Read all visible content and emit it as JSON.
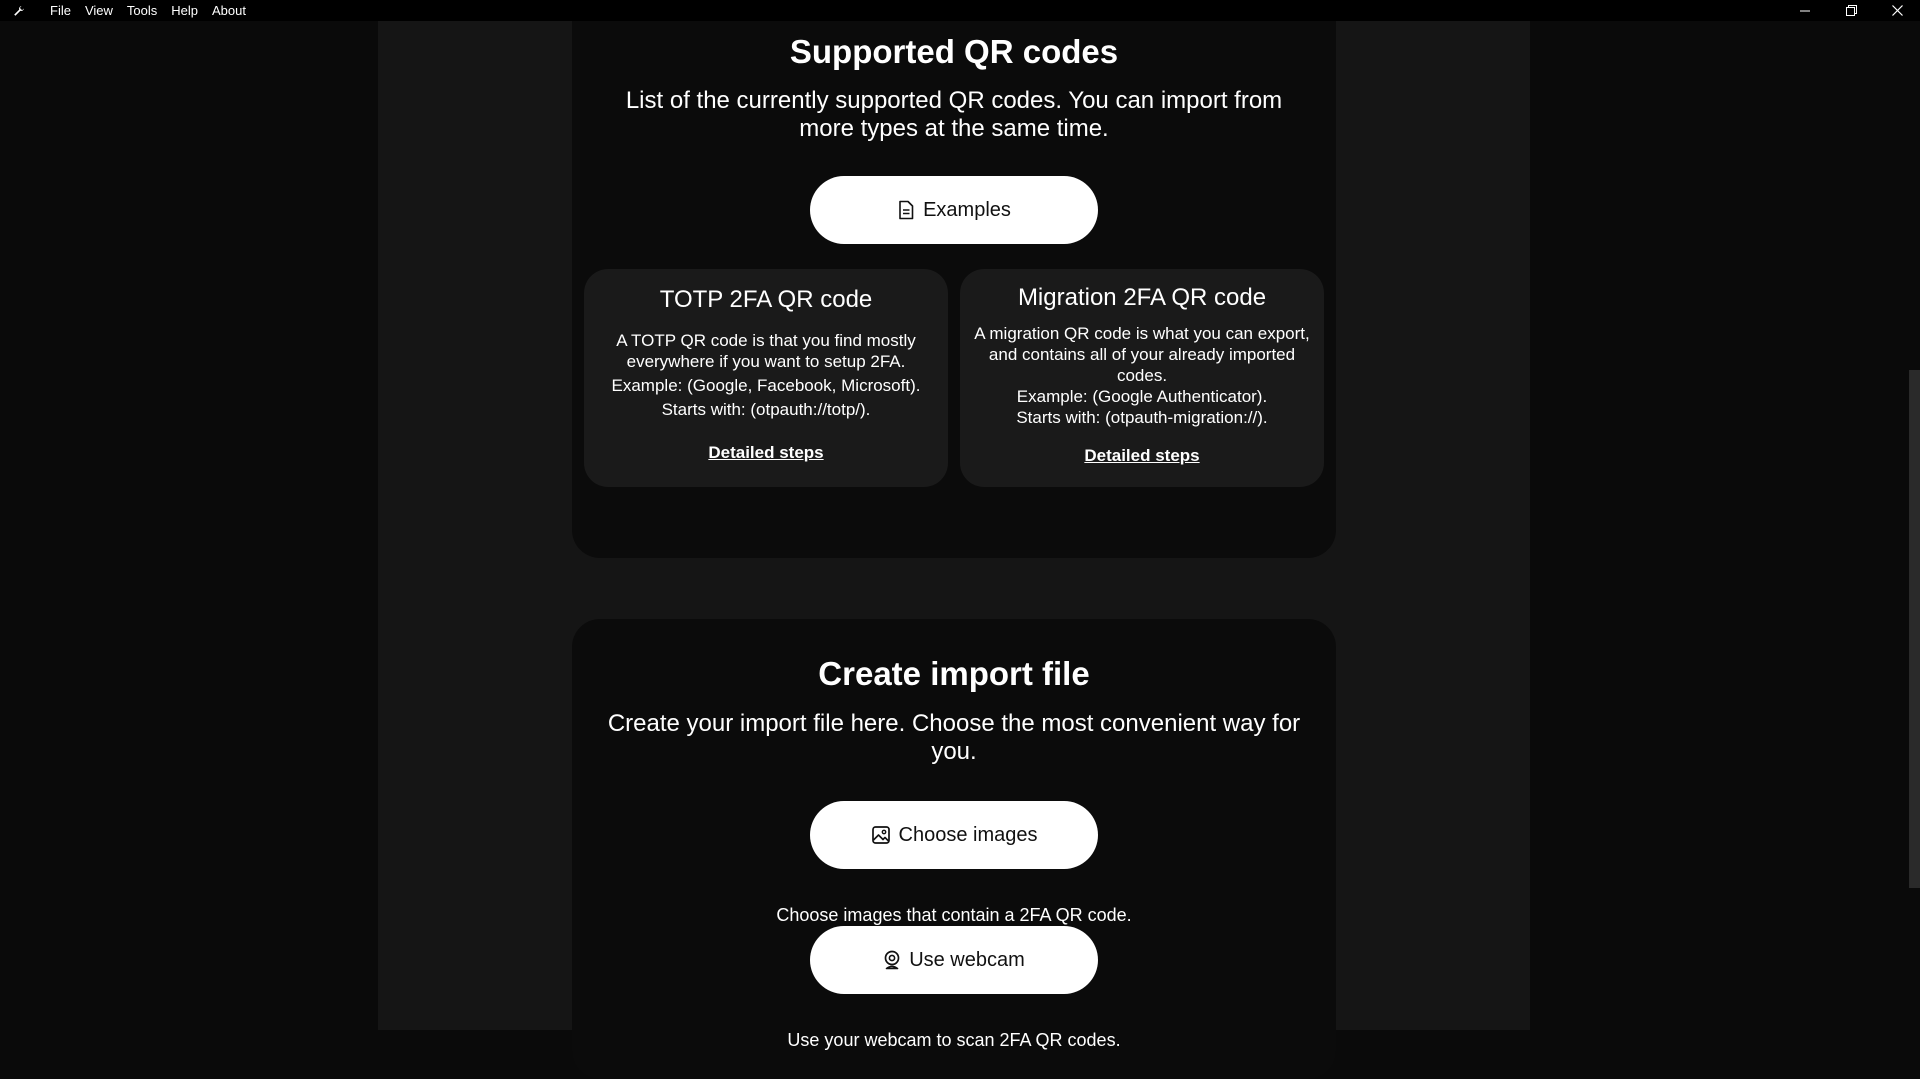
{
  "menubar": {
    "items": [
      "File",
      "View",
      "Tools",
      "Help",
      "About"
    ]
  },
  "supported": {
    "title": "Supported QR codes",
    "description": "List of the currently supported QR codes. You can import from more types at the same time.",
    "examples_button": "Examples",
    "totp": {
      "title": "TOTP 2FA QR code",
      "line1": "A TOTP QR code is that you find mostly everywhere if you want to setup 2FA.",
      "line2": "Example: (Google, Facebook, Microsoft).",
      "line3": "Starts with: (otpauth://totp/).",
      "link": "Detailed steps"
    },
    "migration": {
      "title": "Migration 2FA QR code",
      "line1": "A migration QR code is what you can export, and contains all of your already imported codes.",
      "line2": "Example: (Google Authenticator).",
      "line3": "Starts with: (otpauth-migration://).",
      "link": "Detailed steps"
    }
  },
  "import": {
    "title": "Create import file",
    "description": "Create your import file here. Choose the most convenient way for you.",
    "choose_images_button": "Choose images",
    "choose_images_help": "Choose images that contain a 2FA QR code.",
    "webcam_button": "Use webcam",
    "webcam_help": "Use your webcam to scan 2FA QR codes."
  },
  "icons": {
    "app": "wrench-icon",
    "examples": "document-icon",
    "choose_images": "image-icon",
    "webcam": "webcam-icon"
  }
}
